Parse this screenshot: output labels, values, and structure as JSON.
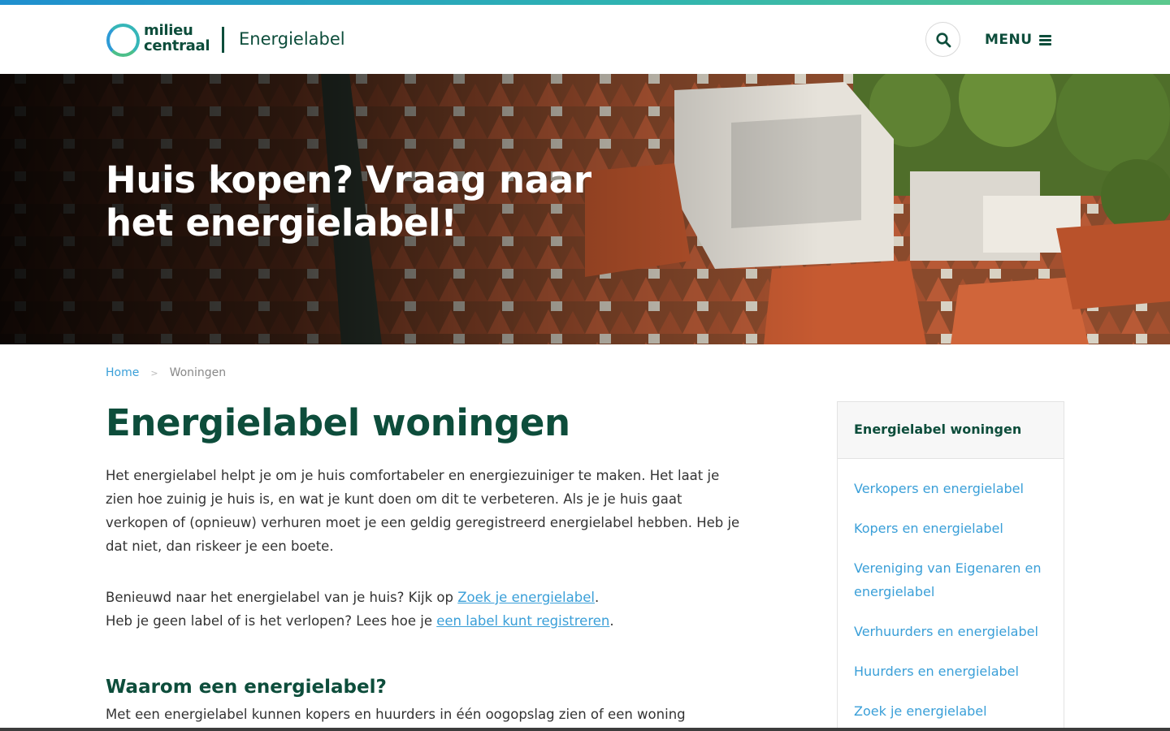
{
  "header": {
    "logo_line1": "milieu",
    "logo_line2": "centraal",
    "site_name": "Energielabel",
    "menu_label": "MENU"
  },
  "hero": {
    "title_line1": "Huis kopen? Vraag naar",
    "title_line2": "het energielabel!"
  },
  "breadcrumb": {
    "home": "Home",
    "separator": ">",
    "current": "Woningen"
  },
  "main": {
    "title": "Energielabel woningen",
    "intro": "Het energielabel helpt je om je huis comfortabeler en energiezuiniger te maken. Het laat je zien hoe zuinig je huis is, en wat je kunt doen om dit te verbeteren. Als je je huis gaat verkopen of (opnieuw) verhuren moet je een geldig geregistreerd energielabel hebben. Heb je dat niet, dan riskeer je een boete.",
    "para2_line1_text": "Benieuwd naar het energielabel van je huis? Kijk op ",
    "para2_line1_link": "Zoek je energielabel",
    "para2_line1_end": ".",
    "para2_line2_text": "Heb je geen label of is het verlopen? Lees hoe je ",
    "para2_line2_link": "een label kunt registreren",
    "para2_line2_end": ".",
    "subheading": "Waarom een energielabel?",
    "para3": "Met een energielabel kunnen kopers en huurders in één oogopslag zien of een woning"
  },
  "sidebar": {
    "heading": "Energielabel woningen",
    "items": [
      {
        "label": "Verkopers en energielabel"
      },
      {
        "label": "Kopers en energielabel"
      },
      {
        "label": "Vereniging van Eigenaren en energielabel"
      },
      {
        "label": "Verhuurders en energielabel"
      },
      {
        "label": "Huurders en energielabel"
      },
      {
        "label": "Zoek je energielabel"
      }
    ]
  },
  "colors": {
    "brand_dark_green": "#0d4d3b",
    "link_blue": "#3a9fd8",
    "stripe_start": "#1f8fcf",
    "stripe_end": "#5cc98e"
  },
  "icons": {
    "search": "search-icon",
    "menu": "hamburger-icon",
    "logo": "milieu-centraal-logo"
  }
}
